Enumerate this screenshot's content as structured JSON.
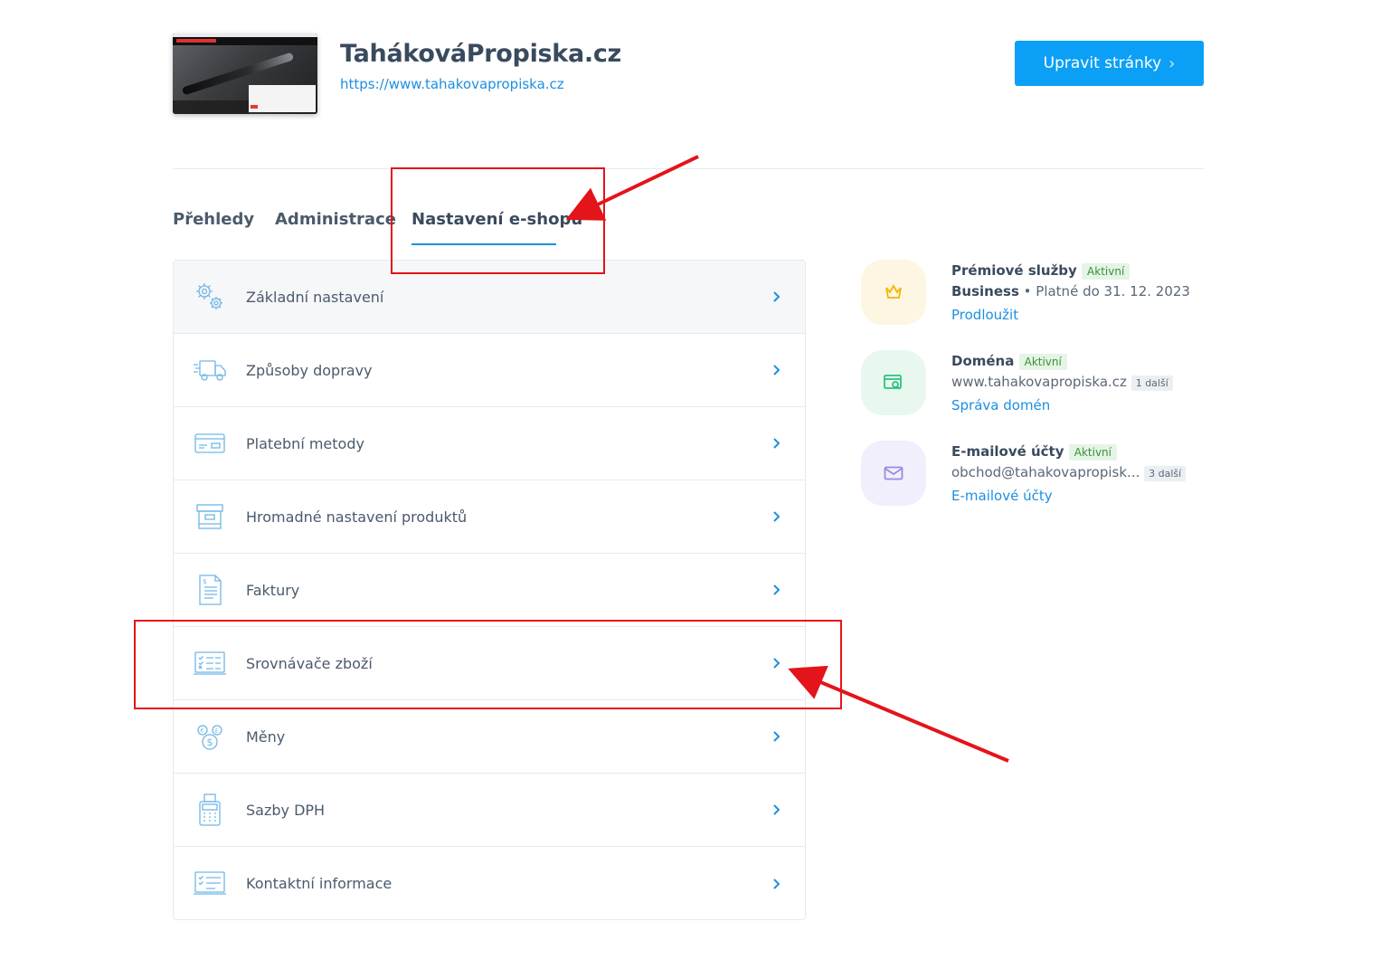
{
  "site": {
    "title": "TahákováPropiska.cz",
    "url": "https://www.tahakovapropiska.cz",
    "edit_button": "Upravit stránky",
    "edit_button_chevron": "›"
  },
  "tabs": [
    {
      "label": "Přehledy",
      "active": false
    },
    {
      "label": "Administrace",
      "active": false
    },
    {
      "label": "Nastavení e-shopu",
      "active": true
    }
  ],
  "menu": {
    "items": [
      {
        "label": "Základní nastavení",
        "icon": "gears-icon"
      },
      {
        "label": "Způsoby dopravy",
        "icon": "truck-icon"
      },
      {
        "label": "Platební metody",
        "icon": "credit-card-icon"
      },
      {
        "label": "Hromadné nastavení produktů",
        "icon": "box-icon"
      },
      {
        "label": "Faktury",
        "icon": "invoice-icon"
      },
      {
        "label": "Srovnávače zboží",
        "icon": "comparison-list-icon"
      },
      {
        "label": "Měny",
        "icon": "currency-coins-icon"
      },
      {
        "label": "Sazby DPH",
        "icon": "cash-register-icon"
      },
      {
        "label": "Kontaktní informace",
        "icon": "contact-laptop-icon"
      }
    ]
  },
  "services": [
    {
      "title": "Prémiové služby",
      "badge": "Aktivní",
      "line_bold": "Business",
      "line_rest": " • Platné do 31. 12. 2023",
      "extra_badge": "",
      "link": "Prodloužit",
      "icon": "crown-icon",
      "bg": "#fdf6e3",
      "color": "#f2b705"
    },
    {
      "title": "Doména",
      "badge": "Aktivní",
      "line_bold": "",
      "line_rest": "www.tahakovapropiska.cz",
      "extra_badge": "1 další",
      "link": "Správa domén",
      "icon": "domain-search-icon",
      "bg": "#e8f8ef",
      "color": "#2ec27e"
    },
    {
      "title": "E-mailové účty",
      "badge": "Aktivní",
      "line_bold": "",
      "line_rest": "obchod@tahakovapropisk...",
      "extra_badge": "3 další",
      "link": "E-mailové účty",
      "icon": "envelope-icon",
      "bg": "#f1effb",
      "color": "#9b8ae0"
    }
  ],
  "colors": {
    "accent": "#1d8fe0",
    "button": "#0ba0f5",
    "annotation": "#e3141a"
  }
}
